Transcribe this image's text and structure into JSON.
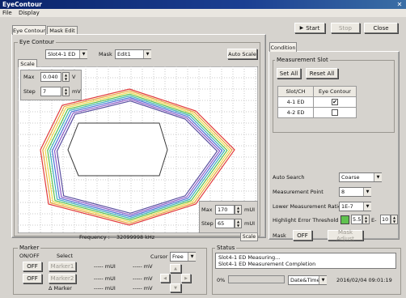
{
  "window": {
    "title": "EyeContour"
  },
  "menu": [
    "File",
    "Display"
  ],
  "tabs": [
    "Eye Contour",
    "Mask Edit"
  ],
  "toolbar": {
    "start": "Start",
    "stop": "Stop",
    "close": "Close"
  },
  "eye_contour": {
    "group_label": "Eye Contour",
    "slot_select": "Slot4-1 ED",
    "mask_label": "Mask",
    "mask_select": "Edit1",
    "auto_scale": "Auto Scale",
    "scale_tab": "Scale",
    "v_max_label": "Max",
    "v_max_value": "0.040",
    "v_unit": "V",
    "v_step_label": "Step",
    "v_step_value": "7",
    "v_step_unit": "mV",
    "frequency_label": "Frequency :",
    "frequency_value": "32099998 kHz",
    "h_max_label": "Max",
    "h_max_value": "170",
    "h_step_label": "Step",
    "h_step_value": "65",
    "h_unit": "mUI",
    "h_scale": "Scale"
  },
  "condition": {
    "tab": "Condition",
    "measurement_slot_label": "Measurement Slot",
    "set_all": "Set All",
    "reset_all": "Reset All",
    "table_headers": [
      "Slot/CH",
      "Eye Contour"
    ],
    "rows": [
      {
        "slot": "4-1 ED",
        "checked": "✔"
      },
      {
        "slot": "4-2 ED",
        "checked": ""
      }
    ],
    "auto_search_label": "Auto Search",
    "auto_search_value": "Coarse",
    "measurement_point_label": "Measurement Point",
    "measurement_point_value": "8",
    "lower_ratio_label": "Lower Measurement Ratio",
    "lower_ratio_value": "1E-7",
    "highlight_label": "Highlight Error Threshold",
    "highlight_mantissa": "5.5",
    "highlight_e": "E-",
    "highlight_exp": "10",
    "highlight_color": "#5fc24f",
    "mask_label": "Mask",
    "mask_toggle": "OFF",
    "mask_adjust": "Mask Adjust"
  },
  "marker": {
    "group_label": "Marker",
    "onoff_label": "ON/OFF",
    "select_label": "Select",
    "cursor_label": "Cursor",
    "cursor_value": "Free",
    "off1": "OFF",
    "off2": "OFF",
    "marker1": "Marker1",
    "marker2": "Marker2",
    "and_marker": "Δ Marker",
    "mui_placeholder": "----- mUI",
    "mv_placeholder": "----- mV"
  },
  "status": {
    "group_label": "Status",
    "messages": [
      "Slot4-1 ED Measuring...",
      "Slot4-1 ED Measurement Completion"
    ],
    "progress_percent": "0%",
    "progress_value": 0,
    "datetime_select": "Date&Time",
    "datetime_value": "2016/02/04 09:01:19"
  },
  "plot": {
    "contour_colors": [
      "#e23b3b",
      "#e8a33a",
      "#ecd94a",
      "#58c04a",
      "#3ab0b8",
      "#4a6fd6",
      "#8a58c8",
      "#5a4fa0"
    ]
  }
}
